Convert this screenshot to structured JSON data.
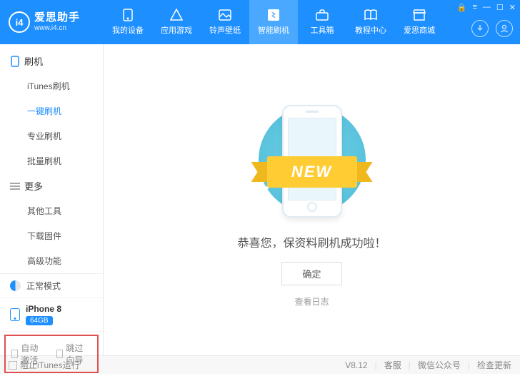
{
  "logo": {
    "mark": "i4",
    "title": "爱思助手",
    "sub": "www.i4.cn"
  },
  "topnav": [
    {
      "label": "我的设备"
    },
    {
      "label": "应用游戏"
    },
    {
      "label": "铃声壁纸"
    },
    {
      "label": "智能刷机"
    },
    {
      "label": "工具箱"
    },
    {
      "label": "教程中心"
    },
    {
      "label": "爱思商城"
    }
  ],
  "sidebar": {
    "group1": {
      "title": "刷机",
      "items": [
        "iTunes刷机",
        "一键刷机",
        "专业刷机",
        "批量刷机"
      ]
    },
    "group2": {
      "title": "更多",
      "items": [
        "其他工具",
        "下载固件",
        "高级功能"
      ]
    },
    "mode": "正常模式",
    "device": {
      "name": "iPhone 8",
      "storage": "64GB"
    },
    "checks": {
      "auto_activate": "自动激活",
      "skip_guide": "跳过向导"
    }
  },
  "main": {
    "banner": "NEW",
    "success": "恭喜您，保资料刷机成功啦！",
    "ok": "确定",
    "view_log": "查看日志"
  },
  "footer": {
    "block_itunes": "阻止iTunes运行",
    "version": "V8.12",
    "support": "客服",
    "wechat": "微信公众号",
    "update": "检查更新"
  }
}
